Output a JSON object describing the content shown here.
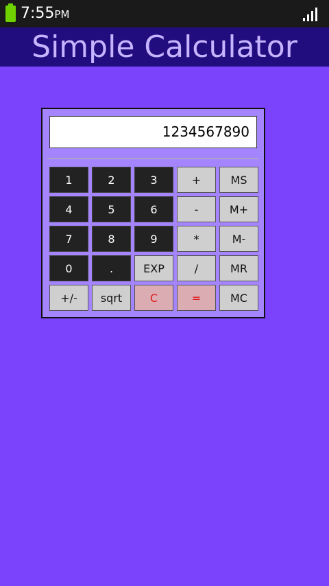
{
  "status_bar": {
    "time": "7:55",
    "ampm": "PM"
  },
  "title": "Simple Calculator",
  "display": {
    "value": "1234567890"
  },
  "keys": [
    {
      "label": "1",
      "style": "dark",
      "name": "digit-1-button"
    },
    {
      "label": "2",
      "style": "dark",
      "name": "digit-2-button"
    },
    {
      "label": "3",
      "style": "dark",
      "name": "digit-3-button"
    },
    {
      "label": "+",
      "style": "light",
      "name": "add-button"
    },
    {
      "label": "MS",
      "style": "light",
      "name": "memory-store-button"
    },
    {
      "label": "4",
      "style": "dark",
      "name": "digit-4-button"
    },
    {
      "label": "5",
      "style": "dark",
      "name": "digit-5-button"
    },
    {
      "label": "6",
      "style": "dark",
      "name": "digit-6-button"
    },
    {
      "label": "-",
      "style": "light",
      "name": "subtract-button"
    },
    {
      "label": "M+",
      "style": "light",
      "name": "memory-add-button"
    },
    {
      "label": "7",
      "style": "dark",
      "name": "digit-7-button"
    },
    {
      "label": "8",
      "style": "dark",
      "name": "digit-8-button"
    },
    {
      "label": "9",
      "style": "dark",
      "name": "digit-9-button"
    },
    {
      "label": "*",
      "style": "light",
      "name": "multiply-button"
    },
    {
      "label": "M-",
      "style": "light",
      "name": "memory-subtract-button"
    },
    {
      "label": "0",
      "style": "dark",
      "name": "digit-0-button"
    },
    {
      "label": ".",
      "style": "dark",
      "name": "decimal-point-button"
    },
    {
      "label": "EXP",
      "style": "light",
      "name": "exponent-button"
    },
    {
      "label": "/",
      "style": "light",
      "name": "divide-button"
    },
    {
      "label": "MR",
      "style": "light",
      "name": "memory-recall-button"
    },
    {
      "label": "+/-",
      "style": "light",
      "name": "sign-toggle-button"
    },
    {
      "label": "sqrt",
      "style": "light",
      "name": "square-root-button"
    },
    {
      "label": "C",
      "style": "red",
      "name": "clear-button"
    },
    {
      "label": "=",
      "style": "red",
      "name": "equals-button"
    },
    {
      "label": "MC",
      "style": "light",
      "name": "memory-clear-button"
    }
  ],
  "colors": {
    "background": "#7b44fc",
    "title_bar": "#210d7e",
    "title_text": "#c7b4ff",
    "panel": "#a585fd",
    "dark_key": "#222222",
    "light_key": "#cfcfcf",
    "red_key_bg": "#dbacb2",
    "red_key_text": "#e11d1d"
  },
  "icons": [
    "battery-icon",
    "signal-strength-icon"
  ]
}
